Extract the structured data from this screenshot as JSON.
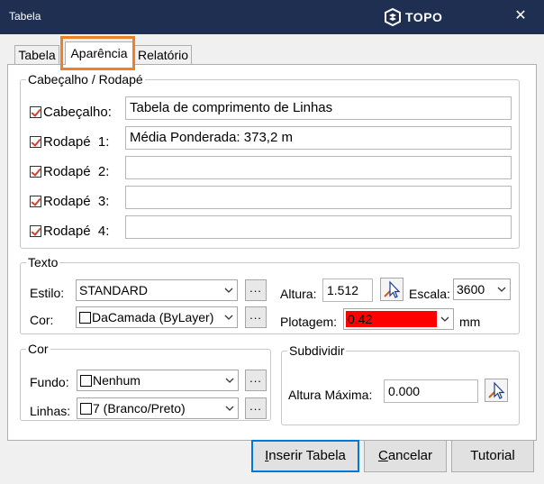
{
  "window": {
    "title": "Tabela",
    "logo_text": "TOPO",
    "close_glyph": "✕"
  },
  "tabs": [
    {
      "label": "Tabela",
      "active": false
    },
    {
      "label": "Aparência",
      "active": true
    },
    {
      "label": "Relatório",
      "active": false
    }
  ],
  "header_footer": {
    "legend": "Cabeçalho / Rodapé",
    "rows": [
      {
        "label": "Cabeçalho:",
        "checked": true,
        "value": "Tabela de comprimento de Linhas"
      },
      {
        "label": "Rodapé  1:",
        "checked": true,
        "value": "Média Ponderada: 373,2 m"
      },
      {
        "label": "Rodapé  2:",
        "checked": true,
        "value": ""
      },
      {
        "label": "Rodapé  3:",
        "checked": true,
        "value": ""
      },
      {
        "label": "Rodapé  4:",
        "checked": true,
        "value": ""
      }
    ]
  },
  "texto": {
    "legend": "Texto",
    "estilo_label": "Estilo:",
    "estilo_value": "STANDARD",
    "cor_label": "Cor:",
    "cor_value": "DaCamada (ByLayer)",
    "altura_label": "Altura:",
    "altura_value": "1.512",
    "escala_label": "Escala:",
    "escala_value": "3600",
    "plotagem_label": "Plotagem:",
    "plotagem_value": "0.42",
    "plotagem_color": "#ff0000",
    "unit": "mm",
    "dots": "..."
  },
  "cor": {
    "legend": "Cor",
    "fundo_label": "Fundo:",
    "fundo_value": "Nenhum",
    "linhas_label": "Linhas:",
    "linhas_value": "7 (Branco/Preto)",
    "dots": "..."
  },
  "subdividir": {
    "legend": "Subdividir",
    "altura_label": "Altura Máxima:",
    "altura_value": "0.000"
  },
  "buttons": {
    "insert_prefix": "I",
    "insert_rest": "nserir Tabela",
    "cancel_prefix": "C",
    "cancel_rest": "ancelar",
    "tutorial": "Tutorial"
  },
  "colors": {
    "titlebar": "#1e2f52",
    "highlight": "#f08024",
    "check": "#d3412e"
  }
}
